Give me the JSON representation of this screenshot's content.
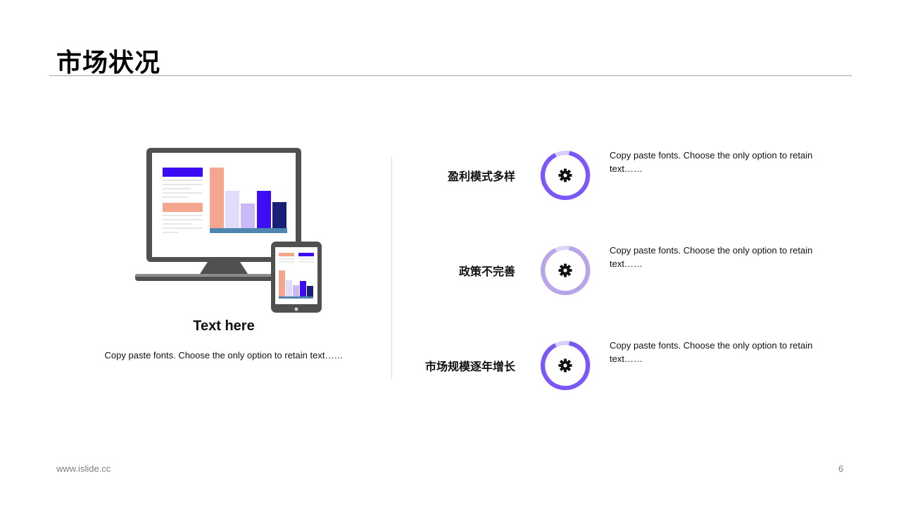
{
  "header": {
    "title": "市场状况"
  },
  "left_panel": {
    "illustration": "monitor-and-tablet-with-bar-chart",
    "heading": "Text here",
    "description": "Copy paste fonts. Choose the only option to retain text……"
  },
  "features": [
    {
      "label": "盈利模式多样",
      "icon": "gear-icon",
      "description": "Copy paste fonts. Choose the only option to retain text……",
      "ring_color": "#7b57f5"
    },
    {
      "label": "政策不完善",
      "icon": "gear-icon",
      "description": "Copy paste fonts. Choose the only option to retain text……",
      "ring_color": "#b7a5e8"
    },
    {
      "label": "市场规模逐年增长",
      "icon": "gear-icon",
      "description": "Copy paste fonts. Choose the only option to retain text……",
      "ring_color": "#7b57f5"
    }
  ],
  "footer": {
    "url": "www.islide.cc",
    "page_number": "6"
  },
  "colors": {
    "accent_purple": "#7b57f5",
    "light_purple": "#b7a5e8",
    "salmon": "#f4a68e",
    "blue_violet": "#3d0cf5",
    "navy": "#1a1f7a",
    "device_gray": "#505050"
  }
}
